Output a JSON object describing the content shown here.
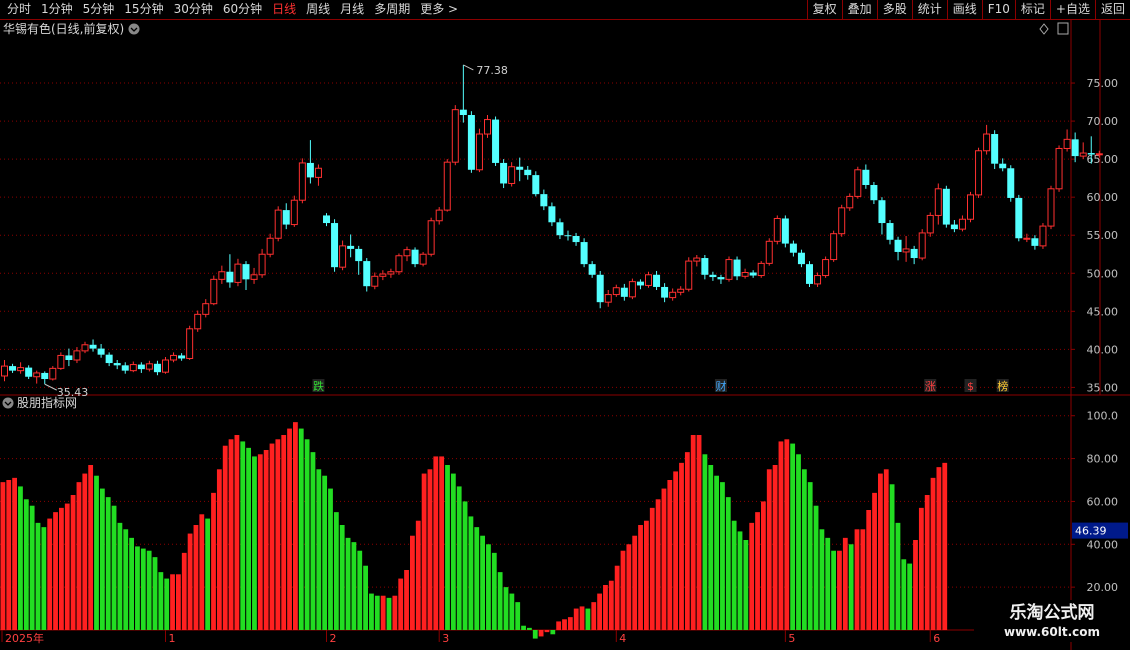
{
  "toolbar": {
    "periods": [
      "分时",
      "1分钟",
      "5分钟",
      "15分钟",
      "30分钟",
      "60分钟",
      "日线",
      "周线",
      "月线",
      "多周期",
      "更多"
    ],
    "active": "日线",
    "more_suffix": ">",
    "right_buttons": [
      "复权",
      "叠加",
      "多股",
      "统计",
      "画线",
      "F10",
      "标记",
      "+自选",
      "返回"
    ]
  },
  "main_panel": {
    "title": "华锡有色(日线,前复权)",
    "high_label": "77.38",
    "low_label": "35.43",
    "y_ticks": [
      "75.00",
      "70.00",
      "65.00",
      "60.00",
      "55.00",
      "50.00",
      "45.00",
      "40.00",
      "35.00"
    ],
    "markers": [
      {
        "text": "跌",
        "color": "#33dd33",
        "idx": 39
      },
      {
        "text": "财",
        "color": "#44aaff",
        "idx": 89
      },
      {
        "text": "涨",
        "color": "#ff4040",
        "idx": 115
      },
      {
        "text": "$",
        "color": "#ff4040",
        "idx": 120
      },
      {
        "text": "榜",
        "color": "#ffcc33",
        "idx": 124
      }
    ]
  },
  "sub_panel": {
    "title": "股朋指标网",
    "y_ticks": [
      "100.0",
      "80.00",
      "60.00",
      "40.00",
      "20.00"
    ],
    "current_value": "46.39"
  },
  "time_axis": {
    "labels": [
      {
        "text": "2025年",
        "idx": 0
      },
      {
        "text": "1",
        "idx": 20
      },
      {
        "text": "2",
        "idx": 40
      },
      {
        "text": "3",
        "idx": 54
      },
      {
        "text": "4",
        "idx": 76
      },
      {
        "text": "5",
        "idx": 97
      },
      {
        "text": "6",
        "idx": 115
      }
    ]
  },
  "watermark": {
    "line1": "乐淘公式网",
    "line2": "www.60lt.com"
  },
  "colors": {
    "up": "#ff3030",
    "down": "#54ffff",
    "grid": "#8b0000",
    "osc_up": "#ff2020",
    "osc_down": "#22dd22"
  },
  "chart_data": {
    "type": "candlestick",
    "y_range": [
      34,
      80
    ],
    "osc_range": [
      0,
      105
    ],
    "candles": [
      [
        36.5,
        37.8,
        35.8,
        38.6
      ],
      [
        37.8,
        37.2,
        36.9,
        38.1
      ],
      [
        37.2,
        37.6,
        36.8,
        38.3
      ],
      [
        37.6,
        36.4,
        36.1,
        37.9
      ],
      [
        36.4,
        36.9,
        35.5,
        37.2
      ],
      [
        36.9,
        36.1,
        35.43,
        37.1
      ],
      [
        36.1,
        37.5,
        35.9,
        37.8
      ],
      [
        37.5,
        39.2,
        37.3,
        39.6
      ],
      [
        39.2,
        38.6,
        37.8,
        40.1
      ],
      [
        38.6,
        39.8,
        38.2,
        40.3
      ],
      [
        39.8,
        40.6,
        39.5,
        41.0
      ],
      [
        40.6,
        40.1,
        39.7,
        41.3
      ],
      [
        40.1,
        39.3,
        38.9,
        40.7
      ],
      [
        39.3,
        38.2,
        37.8,
        39.6
      ],
      [
        38.2,
        37.9,
        37.4,
        38.6
      ],
      [
        37.9,
        37.2,
        36.8,
        38.3
      ],
      [
        37.2,
        38.0,
        37.0,
        38.4
      ],
      [
        38.0,
        37.4,
        36.9,
        38.3
      ],
      [
        37.4,
        38.1,
        37.1,
        38.5
      ],
      [
        38.1,
        37.0,
        36.6,
        38.5
      ],
      [
        37.0,
        38.6,
        36.8,
        39.0
      ],
      [
        38.6,
        39.2,
        38.3,
        39.6
      ],
      [
        39.2,
        38.8,
        38.5,
        39.5
      ],
      [
        38.8,
        42.7,
        38.6,
        43.1
      ],
      [
        42.7,
        44.6,
        42.3,
        45.1
      ],
      [
        44.6,
        46.0,
        44.2,
        46.6
      ],
      [
        46.0,
        49.2,
        45.8,
        49.7
      ],
      [
        49.2,
        50.2,
        48.6,
        51.0
      ],
      [
        50.2,
        48.8,
        48.1,
        52.5
      ],
      [
        48.8,
        51.2,
        48.3,
        51.9
      ],
      [
        51.2,
        49.2,
        47.8,
        51.6
      ],
      [
        49.2,
        49.8,
        48.6,
        50.7
      ],
      [
        49.8,
        52.5,
        49.4,
        53.2
      ],
      [
        52.5,
        54.6,
        52.1,
        55.2
      ],
      [
        54.6,
        58.3,
        54.2,
        58.8
      ],
      [
        58.3,
        56.4,
        55.8,
        59.2
      ],
      [
        56.4,
        59.6,
        56.1,
        60.2
      ],
      [
        59.6,
        64.5,
        59.2,
        65.1
      ],
      [
        64.5,
        62.6,
        61.8,
        67.5
      ],
      [
        62.6,
        63.8,
        61.5,
        64.3
      ],
      [
        57.6,
        56.6,
        56.2,
        57.9
      ],
      [
        56.6,
        50.8,
        50.2,
        57.1
      ],
      [
        50.8,
        53.6,
        50.4,
        54.3
      ],
      [
        53.6,
        53.2,
        52.1,
        55.1
      ],
      [
        53.2,
        51.6,
        49.8,
        53.6
      ],
      [
        51.6,
        48.3,
        47.6,
        52.0
      ],
      [
        48.3,
        49.6,
        47.9,
        50.1
      ],
      [
        49.6,
        49.9,
        49.1,
        50.4
      ],
      [
        49.9,
        50.2,
        49.4,
        50.6
      ],
      [
        50.2,
        52.3,
        49.8,
        52.6
      ],
      [
        52.3,
        53.1,
        51.6,
        53.5
      ],
      [
        53.1,
        51.2,
        50.8,
        53.4
      ],
      [
        51.2,
        52.5,
        50.9,
        52.8
      ],
      [
        52.5,
        56.9,
        52.2,
        57.3
      ],
      [
        56.9,
        58.3,
        56.4,
        58.7
      ],
      [
        58.3,
        64.6,
        58.1,
        65.0
      ],
      [
        64.6,
        71.5,
        64.2,
        72.1
      ],
      [
        71.5,
        70.8,
        69.8,
        77.38
      ],
      [
        70.8,
        63.6,
        63.2,
        71.3
      ],
      [
        63.6,
        68.3,
        63.3,
        69.0
      ],
      [
        68.3,
        70.2,
        67.8,
        70.8
      ],
      [
        70.2,
        64.5,
        64.1,
        70.6
      ],
      [
        64.5,
        61.8,
        61.2,
        65.0
      ],
      [
        61.8,
        64.0,
        61.4,
        64.6
      ],
      [
        64.0,
        63.6,
        62.1,
        65.2
      ],
      [
        63.6,
        62.9,
        62.3,
        64.1
      ],
      [
        62.9,
        60.4,
        60.1,
        63.4
      ],
      [
        60.4,
        58.8,
        58.3,
        61.0
      ],
      [
        58.8,
        56.7,
        56.2,
        59.3
      ],
      [
        56.7,
        55.0,
        54.5,
        57.2
      ],
      [
        55.0,
        54.9,
        54.3,
        55.6
      ],
      [
        54.9,
        54.1,
        53.6,
        55.3
      ],
      [
        54.1,
        51.2,
        50.8,
        54.6
      ],
      [
        51.2,
        49.8,
        49.4,
        51.6
      ],
      [
        49.8,
        46.2,
        45.4,
        50.3
      ],
      [
        46.2,
        47.2,
        45.6,
        47.8
      ],
      [
        47.2,
        48.1,
        46.9,
        48.5
      ],
      [
        48.1,
        46.9,
        46.4,
        48.6
      ],
      [
        46.9,
        48.9,
        46.6,
        49.3
      ],
      [
        48.9,
        48.4,
        47.9,
        49.2
      ],
      [
        48.4,
        49.8,
        48.1,
        50.2
      ],
      [
        49.8,
        48.2,
        47.8,
        50.3
      ],
      [
        48.2,
        46.8,
        46.2,
        48.7
      ],
      [
        46.8,
        47.5,
        46.4,
        48.0
      ],
      [
        47.5,
        47.9,
        47.1,
        48.3
      ],
      [
        47.9,
        51.6,
        47.6,
        52.1
      ],
      [
        51.6,
        52.0,
        50.9,
        52.4
      ],
      [
        52.0,
        49.8,
        49.2,
        52.4
      ],
      [
        49.8,
        49.5,
        49.0,
        50.2
      ],
      [
        49.5,
        49.2,
        48.6,
        49.8
      ],
      [
        49.2,
        51.8,
        48.9,
        52.2
      ],
      [
        51.8,
        49.6,
        49.1,
        52.2
      ],
      [
        49.6,
        50.1,
        49.3,
        50.6
      ],
      [
        50.1,
        49.7,
        49.4,
        50.4
      ],
      [
        49.7,
        51.3,
        49.4,
        51.6
      ],
      [
        51.3,
        54.2,
        51.0,
        54.6
      ],
      [
        54.2,
        57.2,
        53.8,
        57.6
      ],
      [
        57.2,
        53.9,
        53.4,
        57.6
      ],
      [
        53.9,
        52.7,
        52.2,
        54.3
      ],
      [
        52.7,
        51.2,
        50.8,
        53.1
      ],
      [
        51.2,
        48.6,
        48.2,
        51.6
      ],
      [
        48.6,
        49.7,
        48.2,
        50.1
      ],
      [
        49.7,
        51.8,
        49.4,
        52.2
      ],
      [
        51.8,
        55.2,
        51.5,
        55.6
      ],
      [
        55.2,
        58.6,
        54.8,
        59.0
      ],
      [
        58.6,
        60.1,
        58.2,
        60.5
      ],
      [
        60.1,
        63.6,
        59.8,
        64.0
      ],
      [
        63.6,
        61.6,
        61.1,
        64.3
      ],
      [
        61.6,
        59.6,
        59.1,
        62.0
      ],
      [
        59.6,
        56.6,
        55.1,
        60.0
      ],
      [
        56.6,
        54.4,
        53.8,
        57.0
      ],
      [
        54.4,
        52.8,
        51.7,
        54.8
      ],
      [
        52.8,
        53.2,
        51.5,
        54.9
      ],
      [
        53.2,
        52.0,
        51.2,
        53.6
      ],
      [
        52.0,
        55.3,
        51.7,
        55.8
      ],
      [
        55.3,
        57.6,
        54.8,
        58.0
      ],
      [
        57.6,
        61.1,
        56.4,
        61.8
      ],
      [
        61.1,
        56.4,
        56.0,
        61.5
      ],
      [
        56.4,
        55.8,
        55.4,
        57.0
      ],
      [
        55.8,
        57.1,
        55.5,
        57.6
      ],
      [
        57.1,
        60.3,
        56.7,
        60.7
      ],
      [
        60.3,
        66.1,
        59.9,
        66.5
      ],
      [
        66.1,
        68.3,
        65.6,
        69.5
      ],
      [
        68.3,
        64.4,
        63.7,
        68.8
      ],
      [
        64.4,
        63.8,
        63.4,
        65.1
      ],
      [
        63.8,
        59.9,
        59.4,
        64.2
      ],
      [
        59.9,
        54.6,
        54.2,
        60.3
      ],
      [
        54.6,
        54.6,
        54.1,
        55.2
      ],
      [
        54.6,
        53.6,
        53.1,
        55.0
      ],
      [
        53.6,
        56.2,
        53.2,
        56.6
      ],
      [
        56.2,
        61.1,
        55.8,
        61.5
      ],
      [
        61.1,
        66.4,
        60.7,
        66.8
      ],
      [
        66.4,
        67.6,
        66.0,
        68.9
      ],
      [
        67.6,
        65.4,
        64.6,
        68.5
      ],
      [
        65.4,
        65.8,
        65.0,
        67.2
      ],
      [
        65.8,
        65.6,
        64.4,
        68.0
      ],
      [
        65.6,
        65.7,
        65.2,
        66.1
      ]
    ],
    "osc_values": [
      69,
      70,
      71,
      67,
      61,
      58,
      50,
      48,
      52,
      55,
      57,
      59,
      63,
      69,
      73,
      77,
      72,
      66,
      62,
      58,
      50,
      47,
      43,
      39,
      38,
      37,
      34,
      27,
      24,
      26,
      26,
      36,
      45,
      49,
      54,
      52,
      64,
      75,
      86,
      89,
      91,
      88,
      85,
      81,
      82,
      84,
      87,
      89,
      91,
      94,
      97,
      94,
      89,
      83,
      75,
      72,
      66,
      55,
      49,
      43,
      41,
      37,
      30,
      17,
      16,
      16,
      15,
      16,
      24,
      28,
      44,
      51,
      73,
      75,
      81,
      81,
      77,
      73,
      67,
      60,
      53,
      48,
      44,
      40,
      36,
      27,
      20,
      17,
      13,
      2,
      1,
      -4,
      -3,
      -1,
      -2,
      4,
      5,
      6,
      10,
      11,
      10,
      13,
      17,
      21,
      23,
      30,
      37,
      40,
      44,
      49,
      51,
      57,
      61,
      66,
      70,
      74,
      78,
      83,
      91,
      91,
      82,
      77,
      72,
      69,
      62,
      51,
      46,
      42,
      50,
      55,
      60,
      75,
      77,
      88,
      89,
      87,
      82,
      75,
      69,
      58,
      47,
      43,
      37,
      37,
      43,
      40,
      47,
      47,
      56,
      64,
      73,
      75,
      68,
      50,
      33,
      31,
      42,
      57,
      63,
      71,
      76,
      78
    ]
  }
}
